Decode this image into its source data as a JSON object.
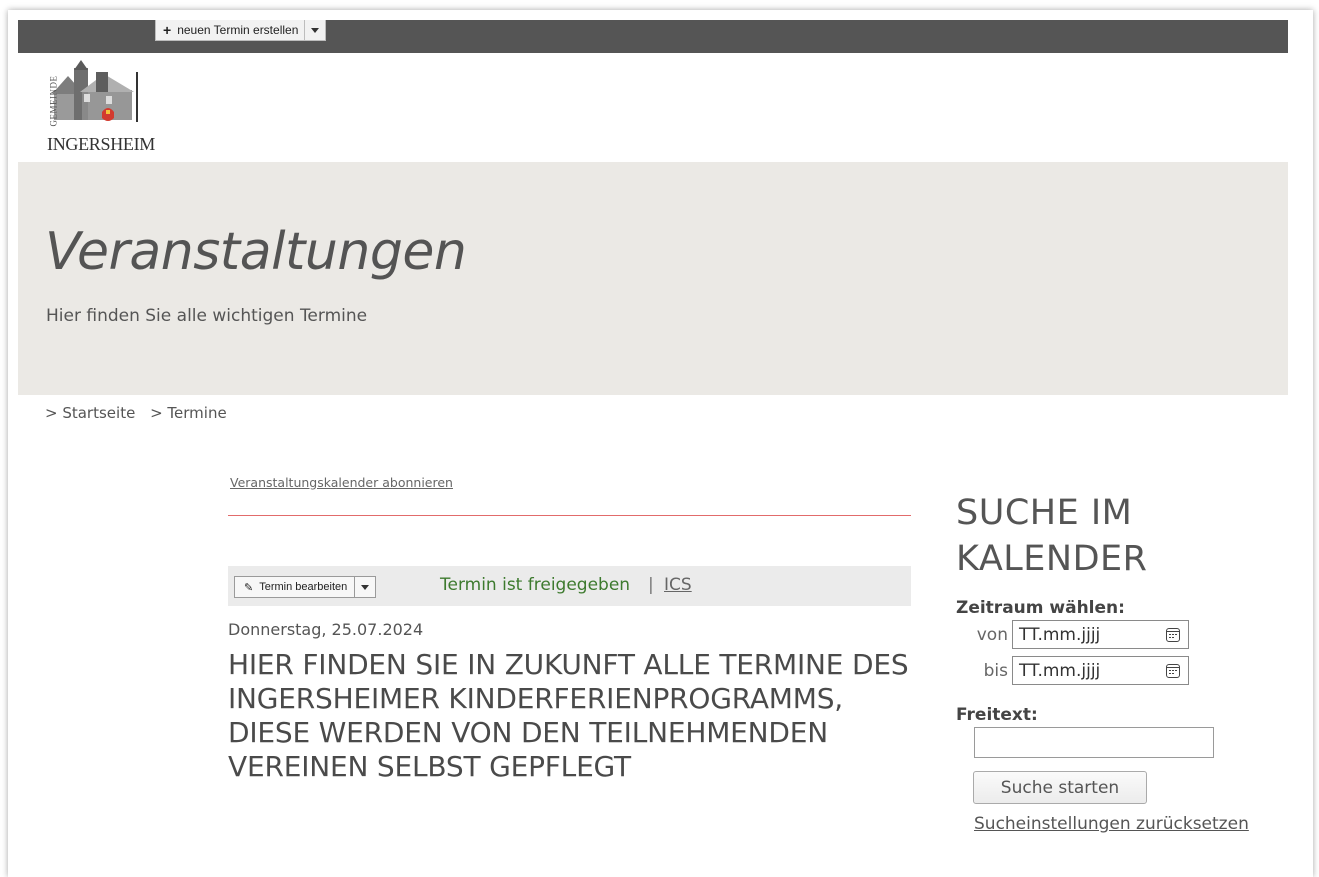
{
  "toolbar": {
    "new_event_label": "neuen Termin erstellen",
    "plus_icon": "+"
  },
  "logo": {
    "name": "INGERSHEIM",
    "prefix": "GEMEINDE"
  },
  "hero": {
    "title": "Veranstaltungen",
    "subtitle": "Hier finden Sie alle wichtigen Termine",
    "background": "#ebe9e5"
  },
  "breadcrumb": {
    "items": [
      "> Startseite",
      "> Termine"
    ]
  },
  "main": {
    "subscribe_link": "Veranstaltungskalender abonnieren",
    "edit_button_label": "Termin bearbeiten",
    "status_text": "Termin ist freigegeben",
    "status_separator": "|",
    "ics_link": "ICS",
    "event_date": "Donnerstag, 25.07.2024",
    "event_title": "HIER FINDEN SIE IN ZUKUNFT ALLE TERMINE DES INGERSHEIMER KINDERFERIENPROGRAMMS, DIESE WERDEN VON DEN TEILNEHMENDEN VEREINEN SELBST GEPFLEGT"
  },
  "sidebar": {
    "title": "SUCHE IM KALENDER",
    "period_label": "Zeitraum wählen:",
    "from_label": "von",
    "to_label": "bis",
    "date_placeholder": "TT.mm.jjjj",
    "freetext_label": "Freitext:",
    "freetext_value": "",
    "search_button": "Suche starten",
    "reset_link": "Sucheinstellungen zurücksetzen"
  },
  "colors": {
    "topbar": "#555555",
    "accent_line": "#e26b6b",
    "status_green": "#3d7a2e"
  }
}
